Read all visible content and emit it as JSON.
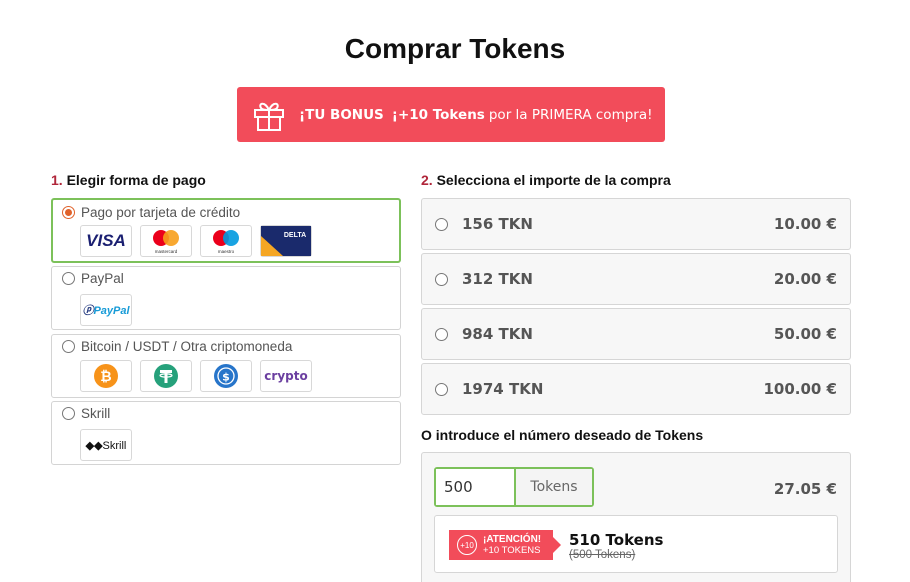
{
  "page": {
    "title": "Comprar Tokens"
  },
  "bonus": {
    "label": "¡TU BONUS",
    "amount": "¡+10 Tokens",
    "text": "por la PRIMERA compra!"
  },
  "payment": {
    "section_num": "1.",
    "section_title": "Elegir forma de pago",
    "methods": [
      {
        "label": "Pago por tarjeta de crédito",
        "selected": true,
        "logos": [
          "visa",
          "mastercard",
          "maestro",
          "delta"
        ]
      },
      {
        "label": "PayPal",
        "selected": false,
        "logos": [
          "paypal"
        ]
      },
      {
        "label": "Bitcoin / USDT / Otra criptomoneda",
        "selected": false,
        "logos": [
          "bitcoin",
          "tether",
          "usdc",
          "crypto"
        ]
      },
      {
        "label": "Skrill",
        "selected": false,
        "logos": [
          "skrill"
        ]
      }
    ],
    "logo_text": {
      "visa": "VISA",
      "delta": "DELTA",
      "paypal": "PayPal",
      "crypto": "crypto",
      "skrill": "Skrill",
      "mastercard": "mastercard",
      "maestro": "maestro"
    }
  },
  "amounts": {
    "section_num": "2.",
    "section_title": "Selecciona el importe de la compra",
    "options": [
      {
        "tokens": "156 TKN",
        "price": "10.00 €"
      },
      {
        "tokens": "312 TKN",
        "price": "20.00 €"
      },
      {
        "tokens": "984 TKN",
        "price": "50.00 €"
      },
      {
        "tokens": "1974 TKN",
        "price": "100.00 €"
      }
    ]
  },
  "custom": {
    "title": "O introduce el número deseado de Tokens",
    "value": "500",
    "suffix": "Tokens",
    "price": "27.05 €",
    "attention": {
      "badge": "+10",
      "line1": "¡ATENCIÓN!",
      "line2": "+10 TOKENS"
    },
    "result_main": "510 Tokens",
    "result_old": "(500 Tokens)"
  },
  "colors": {
    "accent_red": "#f24c5a",
    "select_green": "#7cc15a",
    "radio_orange": "#e0622b",
    "number_red": "#b0263a"
  }
}
